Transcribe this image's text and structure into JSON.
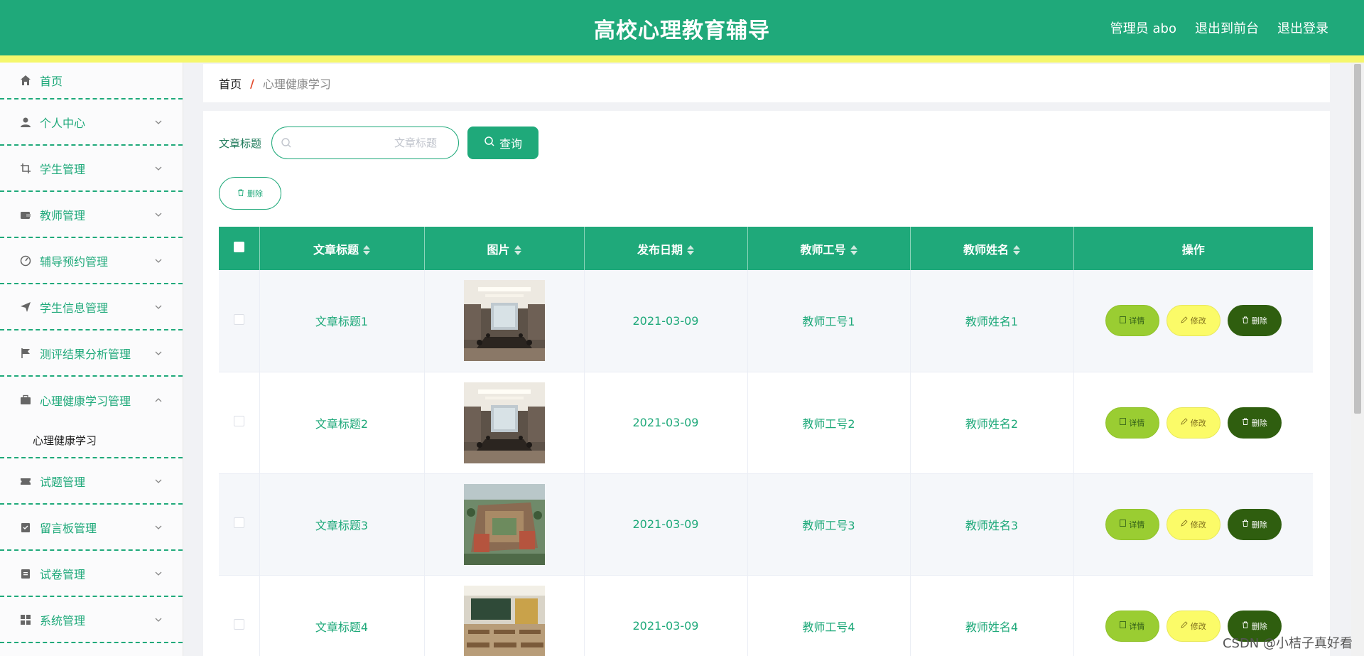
{
  "header": {
    "title": "高校心理教育辅导",
    "user_label": "管理员 abo",
    "to_front_label": "退出到前台",
    "logout_label": "退出登录"
  },
  "colors": {
    "primary": "#1fa97a",
    "accent_bar": "#f5f76c",
    "detail_btn": "#9acd32",
    "edit_btn": "#fbfb68",
    "delete_btn": "#2f5e0f"
  },
  "sidebar": {
    "items": [
      {
        "label": "首页",
        "icon": "home-icon"
      },
      {
        "label": "个人中心",
        "icon": "user-icon"
      },
      {
        "label": "学生管理",
        "icon": "crop-icon"
      },
      {
        "label": "教师管理",
        "icon": "wallet-icon"
      },
      {
        "label": "辅导预约管理",
        "icon": "dashboard-icon"
      },
      {
        "label": "学生信息管理",
        "icon": "send-icon"
      },
      {
        "label": "测评结果分析管理",
        "icon": "flag-icon"
      },
      {
        "label": "心理健康学习管理",
        "icon": "briefcase-icon"
      },
      {
        "label": "试题管理",
        "icon": "ticket-icon"
      },
      {
        "label": "留言板管理",
        "icon": "checklist-icon"
      },
      {
        "label": "试卷管理",
        "icon": "clipboard-icon"
      },
      {
        "label": "系统管理",
        "icon": "grid-icon"
      }
    ],
    "sub_item": "心理健康学习"
  },
  "breadcrumb": {
    "home": "首页",
    "separator": "/",
    "current": "心理健康学习"
  },
  "search": {
    "label": "文章标题",
    "placeholder": "文章标题",
    "button_label": "查询"
  },
  "toolbar": {
    "delete_label": "删除"
  },
  "table": {
    "headers": [
      "文章标题",
      "图片",
      "发布日期",
      "教师工号",
      "教师姓名",
      "操作"
    ],
    "rows": [
      {
        "title": "文章标题1",
        "image": "meeting-room",
        "date": "2021-03-09",
        "teacher_id": "教师工号1",
        "teacher_name": "教师姓名1"
      },
      {
        "title": "文章标题2",
        "image": "meeting-room",
        "date": "2021-03-09",
        "teacher_id": "教师工号2",
        "teacher_name": "教师姓名2"
      },
      {
        "title": "文章标题3",
        "image": "campus-aerial",
        "date": "2021-03-09",
        "teacher_id": "教师工号3",
        "teacher_name": "教师姓名3"
      },
      {
        "title": "文章标题4",
        "image": "classroom",
        "date": "2021-03-09",
        "teacher_id": "教师工号4",
        "teacher_name": "教师姓名4"
      }
    ],
    "actions": {
      "detail": "详情",
      "edit": "修改",
      "delete": "删除"
    }
  },
  "watermark": "CSDN @小桔子真好看"
}
